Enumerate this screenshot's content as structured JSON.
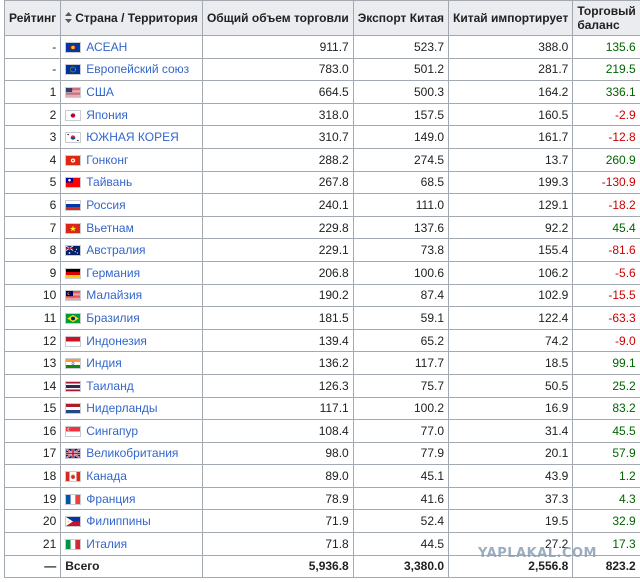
{
  "headers": {
    "rank": "Рейтинг",
    "country": "Страна / Территория",
    "total": "Общий объем торговли",
    "export": "Экспорт Китая",
    "import": "Китай импортирует",
    "balance_line1": "Торговый",
    "balance_line2": "баланс"
  },
  "rows": [
    {
      "rank": "-",
      "country": "АСЕАН",
      "flag": "asean-flag-icon",
      "total": "911.7",
      "export": "523.7",
      "import": "388.0",
      "balance": "135.6",
      "sign": "pos"
    },
    {
      "rank": "-",
      "country": "Европейский союз",
      "flag": "eu-flag-icon",
      "total": "783.0",
      "export": "501.2",
      "import": "281.7",
      "balance": "219.5",
      "sign": "pos"
    },
    {
      "rank": "1",
      "country": "США",
      "flag": "usa-flag-icon",
      "total": "664.5",
      "export": "500.3",
      "import": "164.2",
      "balance": "336.1",
      "sign": "pos"
    },
    {
      "rank": "2",
      "country": "Япония",
      "flag": "japan-flag-icon",
      "total": "318.0",
      "export": "157.5",
      "import": "160.5",
      "balance": "-2.9",
      "sign": "neg"
    },
    {
      "rank": "3",
      "country": "ЮЖНАЯ КОРЕЯ",
      "flag": "south-korea-flag-icon",
      "total": "310.7",
      "export": "149.0",
      "import": "161.7",
      "balance": "-12.8",
      "sign": "neg"
    },
    {
      "rank": "4",
      "country": "Гонконг",
      "flag": "hong-kong-flag-icon",
      "total": "288.2",
      "export": "274.5",
      "import": "13.7",
      "balance": "260.9",
      "sign": "pos"
    },
    {
      "rank": "5",
      "country": "Тайвань",
      "flag": "taiwan-flag-icon",
      "total": "267.8",
      "export": "68.5",
      "import": "199.3",
      "balance": "-130.9",
      "sign": "neg"
    },
    {
      "rank": "6",
      "country": "Россия",
      "flag": "russia-flag-icon",
      "total": "240.1",
      "export": "111.0",
      "import": "129.1",
      "balance": "-18.2",
      "sign": "neg"
    },
    {
      "rank": "7",
      "country": "Вьетнам",
      "flag": "vietnam-flag-icon",
      "total": "229.8",
      "export": "137.6",
      "import": "92.2",
      "balance": "45.4",
      "sign": "pos"
    },
    {
      "rank": "8",
      "country": "Австралия",
      "flag": "australia-flag-icon",
      "total": "229.1",
      "export": "73.8",
      "import": "155.4",
      "balance": "-81.6",
      "sign": "neg"
    },
    {
      "rank": "9",
      "country": "Германия",
      "flag": "germany-flag-icon",
      "total": "206.8",
      "export": "100.6",
      "import": "106.2",
      "balance": "-5.6",
      "sign": "neg"
    },
    {
      "rank": "10",
      "country": "Малайзия",
      "flag": "malaysia-flag-icon",
      "total": "190.2",
      "export": "87.4",
      "import": "102.9",
      "balance": "-15.5",
      "sign": "neg"
    },
    {
      "rank": "11",
      "country": "Бразилия",
      "flag": "brazil-flag-icon",
      "total": "181.5",
      "export": "59.1",
      "import": "122.4",
      "balance": "-63.3",
      "sign": "neg"
    },
    {
      "rank": "12",
      "country": "Индонезия",
      "flag": "indonesia-flag-icon",
      "total": "139.4",
      "export": "65.2",
      "import": "74.2",
      "balance": "-9.0",
      "sign": "neg"
    },
    {
      "rank": "13",
      "country": "Индия",
      "flag": "india-flag-icon",
      "total": "136.2",
      "export": "117.7",
      "import": "18.5",
      "balance": "99.1",
      "sign": "pos"
    },
    {
      "rank": "14",
      "country": "Таиланд",
      "flag": "thailand-flag-icon",
      "total": "126.3",
      "export": "75.7",
      "import": "50.5",
      "balance": "25.2",
      "sign": "pos"
    },
    {
      "rank": "15",
      "country": "Нидерланды",
      "flag": "netherlands-flag-icon",
      "total": "117.1",
      "export": "100.2",
      "import": "16.9",
      "balance": "83.2",
      "sign": "pos"
    },
    {
      "rank": "16",
      "country": "Сингапур",
      "flag": "singapore-flag-icon",
      "total": "108.4",
      "export": "77.0",
      "import": "31.4",
      "balance": "45.5",
      "sign": "pos"
    },
    {
      "rank": "17",
      "country": "Великобритания",
      "flag": "uk-flag-icon",
      "total": "98.0",
      "export": "77.9",
      "import": "20.1",
      "balance": "57.9",
      "sign": "pos"
    },
    {
      "rank": "18",
      "country": "Канада",
      "flag": "canada-flag-icon",
      "total": "89.0",
      "export": "45.1",
      "import": "43.9",
      "balance": "1.2",
      "sign": "pos"
    },
    {
      "rank": "19",
      "country": "Франция",
      "flag": "france-flag-icon",
      "total": "78.9",
      "export": "41.6",
      "import": "37.3",
      "balance": "4.3",
      "sign": "pos"
    },
    {
      "rank": "20",
      "country": "Филиппины",
      "flag": "philippines-flag-icon",
      "total": "71.9",
      "export": "52.4",
      "import": "19.5",
      "balance": "32.9",
      "sign": "pos"
    },
    {
      "rank": "21",
      "country": "Италия",
      "flag": "italy-flag-icon",
      "total": "71.8",
      "export": "44.5",
      "import": "27.2",
      "balance": "17.3",
      "sign": "pos"
    }
  ],
  "totals": {
    "rank": "—",
    "label": "Всего",
    "total": "5,936.8",
    "export": "3,380.0",
    "import": "2,556.8",
    "balance": "823.2"
  },
  "watermark": "YAPLAKAL.COM",
  "colors": {
    "positive": "#006400",
    "negative": "#cc0000",
    "link": "#3366cc",
    "header_bg": "#eaecf0"
  }
}
